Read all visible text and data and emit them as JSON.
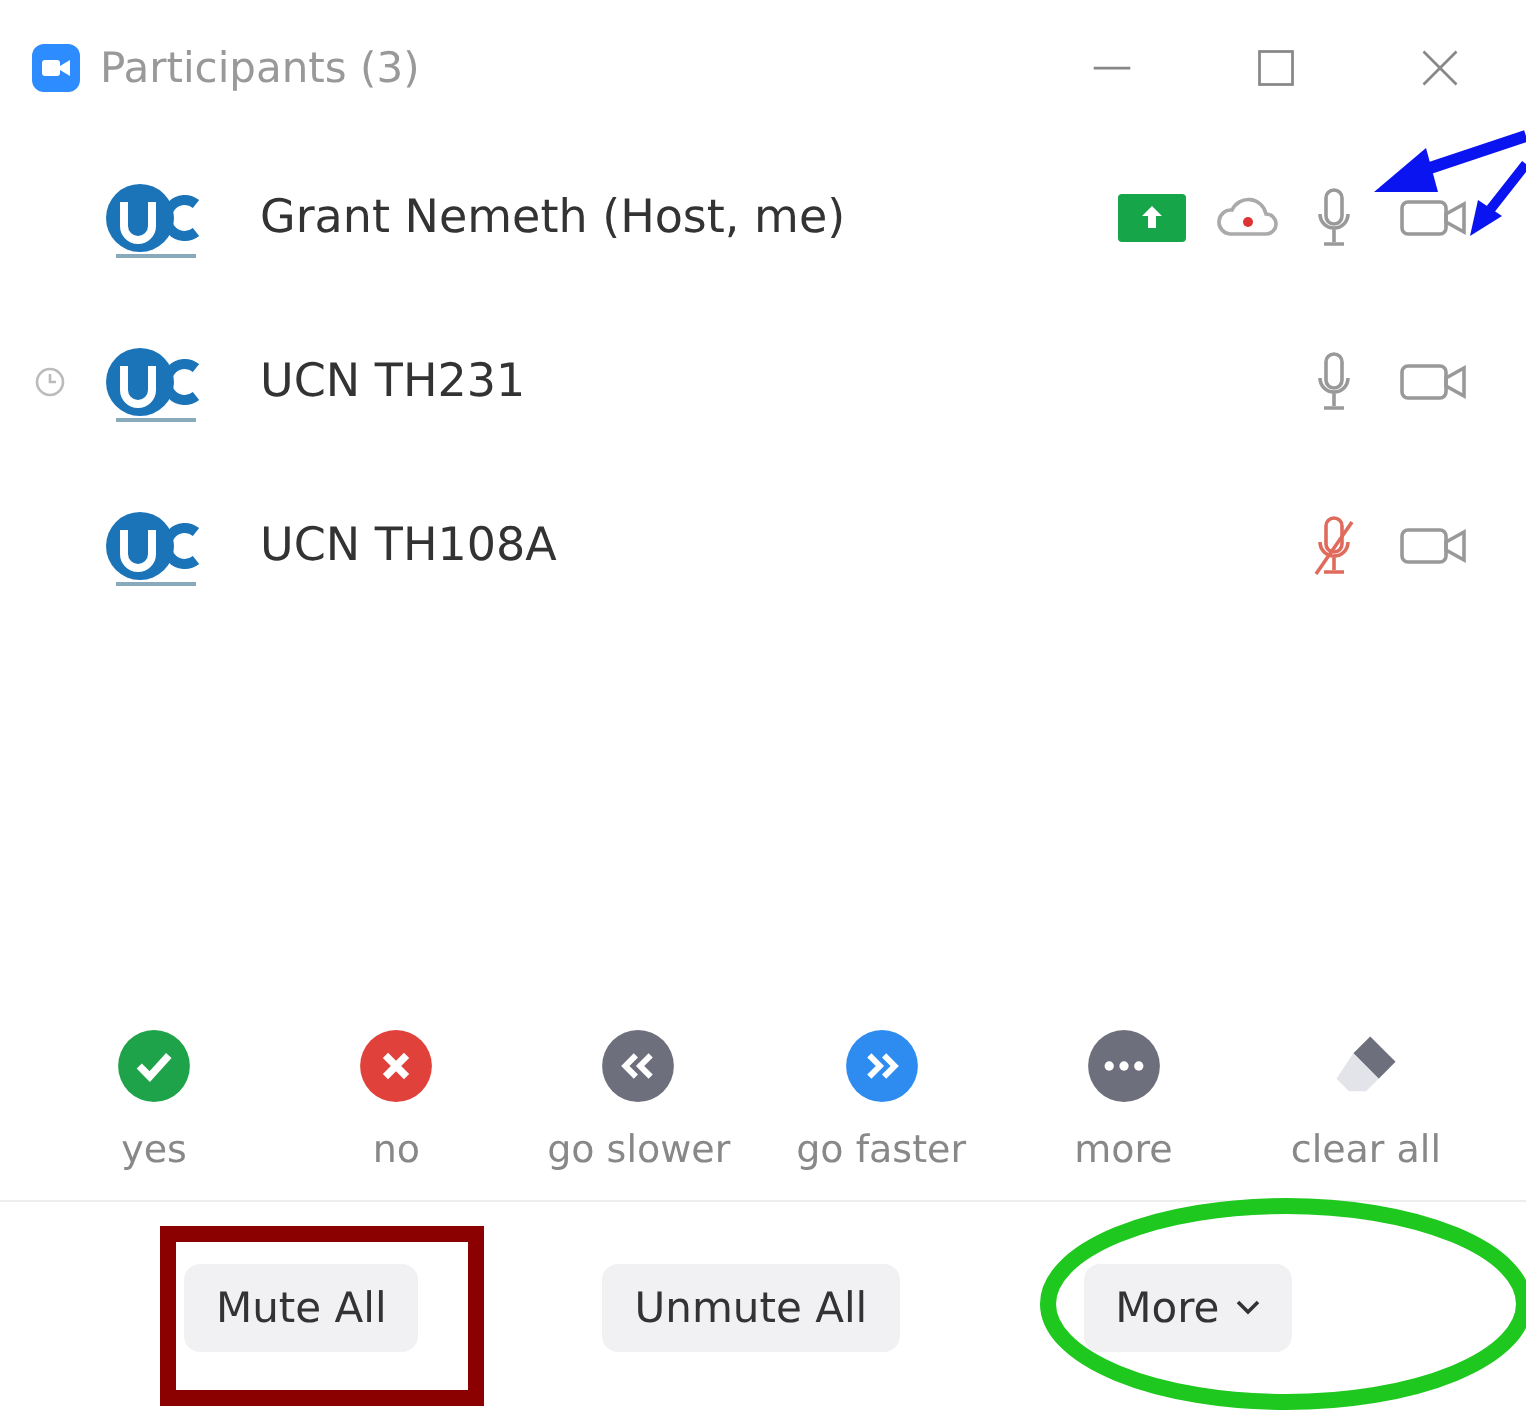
{
  "window": {
    "title": "Participants (3)"
  },
  "participants": [
    {
      "name": "Grant Nemeth (Host, me)",
      "waiting": false,
      "sharing": true,
      "recording": true,
      "muted": false
    },
    {
      "name": "UCN TH231",
      "waiting": true,
      "sharing": false,
      "recording": false,
      "muted": false
    },
    {
      "name": "UCN TH108A",
      "waiting": false,
      "sharing": false,
      "recording": false,
      "muted": true
    }
  ],
  "reactions": [
    {
      "label": "yes",
      "kind": "yes"
    },
    {
      "label": "no",
      "kind": "no"
    },
    {
      "label": "go slower",
      "kind": "slower"
    },
    {
      "label": "go faster",
      "kind": "faster"
    },
    {
      "label": "more",
      "kind": "more"
    },
    {
      "label": "clear all",
      "kind": "clear"
    }
  ],
  "buttons": [
    {
      "label": "Mute All",
      "caret": false
    },
    {
      "label": "Unmute All",
      "caret": false
    },
    {
      "label": "More",
      "caret": true
    }
  ]
}
